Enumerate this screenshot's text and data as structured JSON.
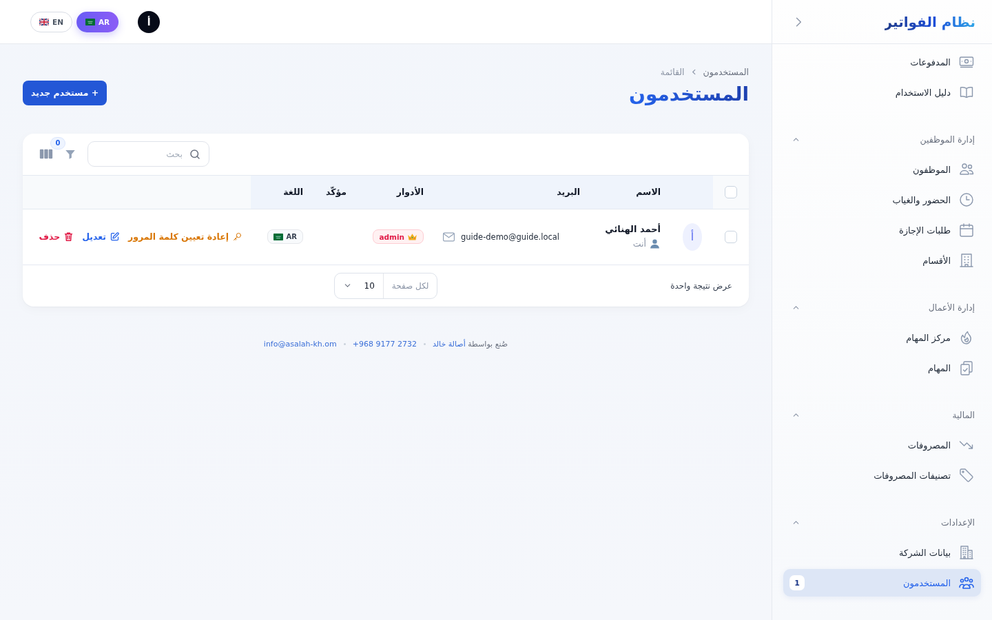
{
  "sidebar": {
    "logo": "نظام الفواتير",
    "items": [
      {
        "label": "المدفوعات",
        "selected": false
      },
      {
        "label": "دليل الاستخدام",
        "selected": false
      }
    ],
    "sections": [
      {
        "title": "إدارة الموظفين",
        "expanded": true,
        "items": [
          {
            "label": "الموظفون",
            "selected": false
          },
          {
            "label": "الحضور والغياب",
            "selected": false
          },
          {
            "label": "طلبات الإجازة",
            "selected": false
          },
          {
            "label": "الأقسام",
            "selected": false
          }
        ]
      },
      {
        "title": "إدارة الأعمال",
        "expanded": true,
        "items": [
          {
            "label": "مركز المهام",
            "selected": false
          },
          {
            "label": "المهام",
            "selected": false
          }
        ]
      },
      {
        "title": "المالية",
        "expanded": true,
        "items": [
          {
            "label": "المصروفات",
            "selected": false
          },
          {
            "label": "تصنيفات المصروفات",
            "selected": false
          }
        ]
      },
      {
        "title": "الإعدادات",
        "expanded": true,
        "items": [
          {
            "label": "بيانات الشركة",
            "selected": false
          },
          {
            "label": "المستخدمون",
            "selected": true,
            "badge": "1"
          }
        ]
      }
    ]
  },
  "topbar": {
    "user_initial": "أ",
    "languages": [
      {
        "label": "AR",
        "selected": true
      },
      {
        "label": "EN",
        "selected": false
      }
    ]
  },
  "header": {
    "breadcrumb": [
      "المستخدمون",
      "القائمة"
    ],
    "title": "المستخدمون",
    "new_button": "+ مستخدم جديد"
  },
  "table": {
    "search": {
      "placeholder": "بحث"
    },
    "filter_count": "0",
    "select_all": {
      "checked": false
    },
    "columns": [
      "الاسم",
      "البريد",
      "الأدوار",
      "مؤكّد",
      "اللغة"
    ],
    "rows": [
      {
        "checked": false,
        "initial": "أ",
        "name": "أحمد الهنائي",
        "tag": "أنت",
        "email": "guide-demo@guide.local",
        "role": "admin",
        "language": "AR",
        "actions": [
          {
            "kind": "reset",
            "label": "إعادة تعيين كلمة المرور"
          },
          {
            "kind": "edit",
            "label": "تعديل"
          },
          {
            "kind": "delete",
            "label": "حذف"
          }
        ]
      }
    ],
    "result_text": "عرض نتيجة واحدة",
    "per_page": {
      "label": "لكل صفحة",
      "value": "10"
    }
  },
  "footer": {
    "credit": "صُنع بواسطة",
    "author": "أصالة خالد",
    "phone": "+968 9177 2732",
    "email": "info@asalah-kh.om"
  }
}
